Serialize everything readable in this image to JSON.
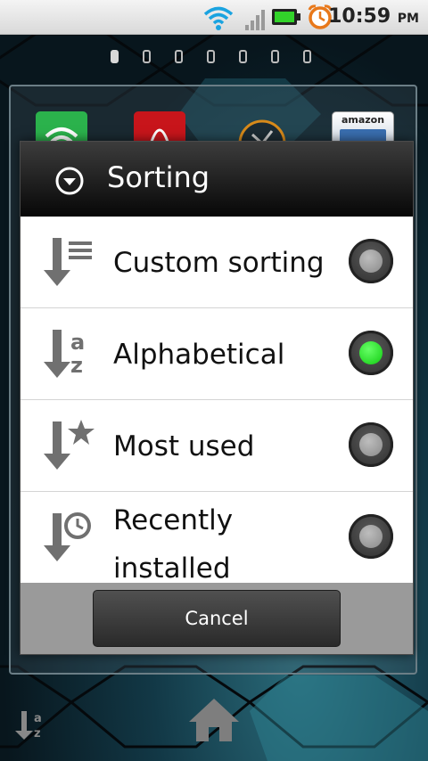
{
  "status_bar": {
    "time": "10:59",
    "ampm": "PM",
    "icons": [
      "wifi-icon",
      "signal-icon",
      "battery-icon",
      "alarm-icon"
    ]
  },
  "home": {
    "page_count": 7,
    "active_page": 1,
    "partial_app_label": "amazon",
    "dock": [
      "sort-az-icon",
      "home-icon"
    ]
  },
  "dialog": {
    "title": "Sorting",
    "options": [
      {
        "label": "Custom sorting",
        "icon": "custom-sort-icon",
        "selected": false
      },
      {
        "label": "Alphabetical",
        "icon": "sort-az-icon",
        "selected": true
      },
      {
        "label": "Most used",
        "icon": "sort-star-icon",
        "selected": false
      },
      {
        "label_line1": "Recently",
        "label_line2": "installed",
        "icon": "sort-recent-icon",
        "selected": false
      }
    ],
    "cancel_label": "Cancel"
  },
  "colors": {
    "radio_checked": "#11cc11",
    "dialog_header": "#070707",
    "footer": "#9a9a9a"
  }
}
